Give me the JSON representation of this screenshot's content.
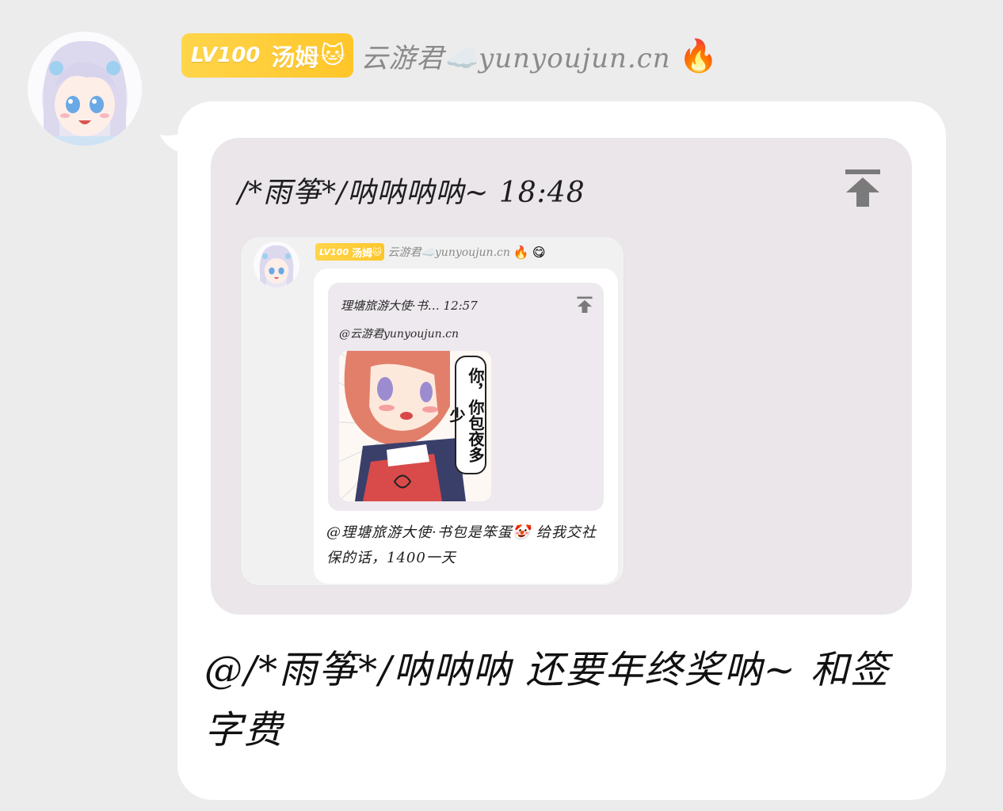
{
  "header": {
    "level": "LV100",
    "title_tag": "汤姆",
    "title_emoji": "🐱",
    "nickname": "云游君☁️yunyoujun.cn",
    "badge_emoji": "🔥",
    "badge_color": "#ffc62a"
  },
  "reply": {
    "header": "/*雨筝*/呐呐呐呐~ 18:48",
    "scroll_icon": "arrow-up-to-top-icon"
  },
  "nested": {
    "header": {
      "level": "LV100",
      "title_tag": "汤姆",
      "title_emoji": "🐱",
      "nickname": "云游君☁️yunyoujun.cn",
      "emoji_1": "🔥",
      "emoji_2": "😋"
    },
    "reply": {
      "header": "理塘旅游大使·书… 12:57",
      "mention": "@云游君yunyoujun.cn",
      "meme_text": "你，你包夜多少"
    },
    "message": "@理塘旅游大使·书包是笨蛋🤡 给我交社保的话，1400一天"
  },
  "message": {
    "text": "@/*雨筝*/呐呐呐 还要年终奖呐~ 和签字费"
  }
}
